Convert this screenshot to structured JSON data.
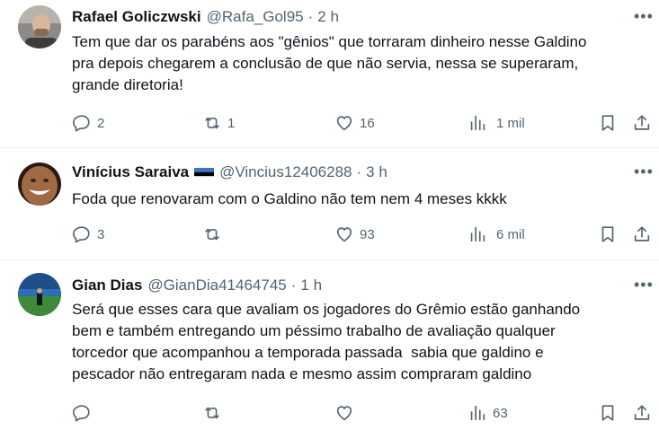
{
  "tweets": [
    {
      "name": "Rafael Goliczwski",
      "handle": "@Rafa_Gol95",
      "time": "2 h",
      "text": "Tem que dar os parabéns aos \"gênios\" que torraram dinheiro nesse Galdino\npra depois chegarem a conclusão de que não servia, nessa se superaram,\ngrande diretoria!",
      "replies": "2",
      "retweets": "1",
      "likes": "16",
      "views": "1 mil",
      "flag": false
    },
    {
      "name": "Vinícius Saraiva",
      "handle": "@Vincius12406288",
      "time": "3 h",
      "text": "Foda que renovaram com o Galdino não tem nem 4 meses kkkk",
      "replies": "3",
      "retweets": "",
      "likes": "93",
      "views": "6 mil",
      "flag": true
    },
    {
      "name": "Gian Dias",
      "handle": "@GianDia41464745",
      "time": "1 h",
      "text": "Será que esses cara que avaliam os jogadores do Grêmio estão ganhando\nbem e também entregando um péssimo trabalho de avaliação qualquer\ntorcedor que acompanhou a temporada passada  sabia que galdino e\npescador não entregaram nada e mesmo assim compraram galdino",
      "replies": "",
      "retweets": "",
      "likes": "",
      "views": "63",
      "flag": false
    }
  ],
  "dot": "·",
  "more_icon": "more-horizontal-icon",
  "colors": {
    "text": "#0f1419",
    "secondary": "#536471",
    "divider": "#eff3f4"
  }
}
